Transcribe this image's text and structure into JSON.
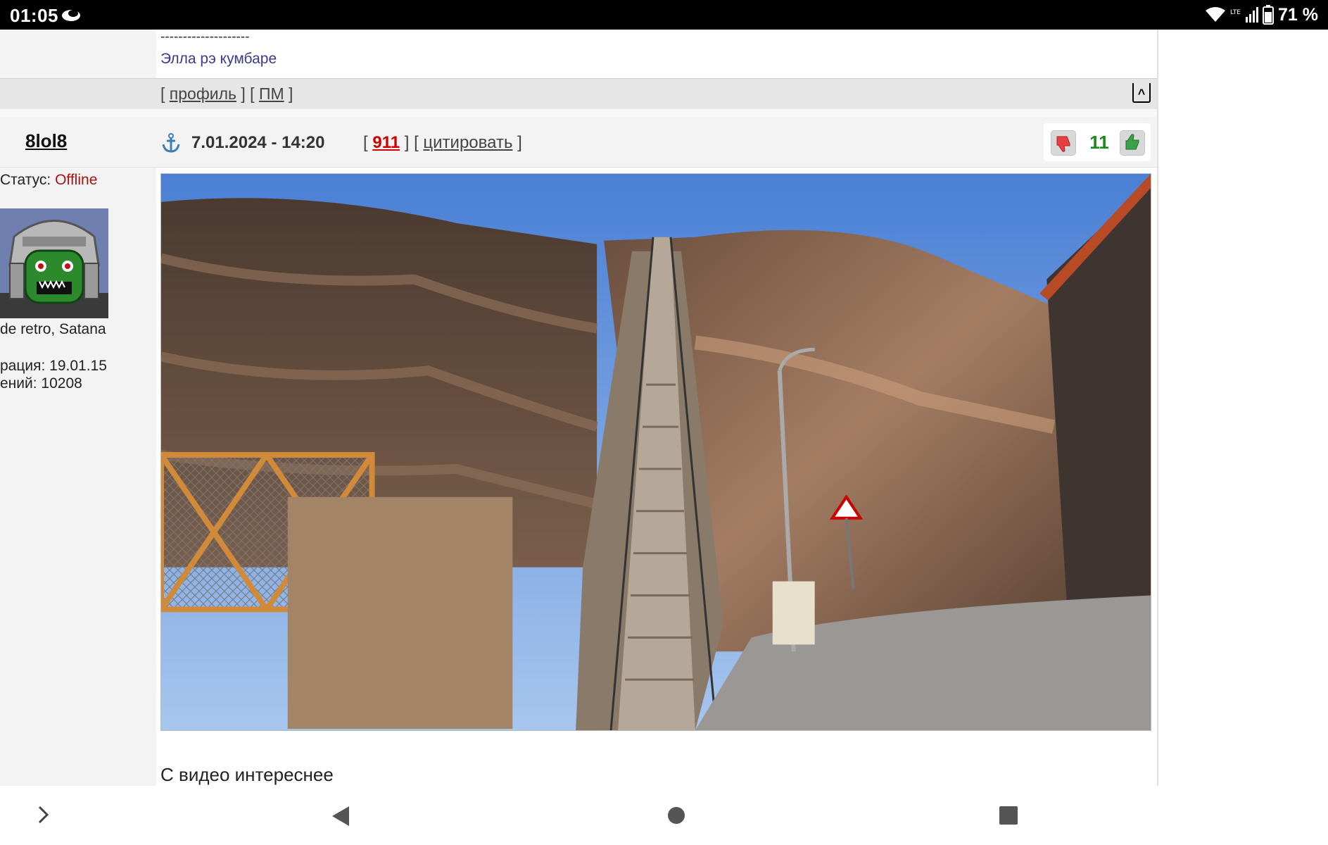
{
  "status_bar": {
    "time": "01:05",
    "battery_percent": "71 %",
    "network": "LTE",
    "icons": [
      "notification-icon",
      "wifi-icon",
      "signal-icon",
      "battery-icon"
    ]
  },
  "previous_post": {
    "signature_dashes": "--------------------",
    "signature_text": "Элла рэ кумбаре",
    "footer_open_1": "[ ",
    "profile_link": "профиль",
    "footer_mid": " ] [ ",
    "pm_link": "ПМ",
    "footer_close": " ]",
    "top_icon_label": "^"
  },
  "post": {
    "username": "8lol8",
    "date": "7.01.2024 - 14:20",
    "bracket_open": "[ ",
    "post_number": "911",
    "bracket_mid": " ] [ ",
    "quote_label": "цитировать",
    "bracket_close": " ]",
    "rating": "11",
    "image_alt": "",
    "text": "С видео интереснее"
  },
  "user_info": {
    "status_label": "Статус: ",
    "status_value": "Offline",
    "title": "de retro, Satana",
    "registration": "рация: 19.01.15",
    "messages": "ений: 10208"
  },
  "colors": {
    "status_offline": "#aa1111",
    "post_number": "#cc0000",
    "rating": "#1a8a1a",
    "signature": "#3a3a8c"
  }
}
